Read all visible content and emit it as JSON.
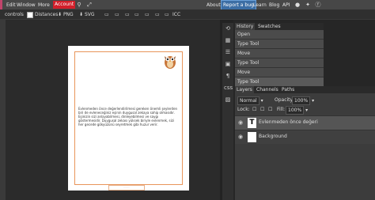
{
  "menu": {
    "items": [
      "Edit",
      "Window",
      "More"
    ],
    "account": "Account",
    "right_links": [
      "About",
      "Learn",
      "Blog",
      "API"
    ],
    "report_bug": "Report a bug"
  },
  "options": {
    "controls_label": "controls",
    "distances_label": "Distances",
    "png_label": "PNG",
    "svg_label": "SVG",
    "icc_label": "ICC"
  },
  "history": {
    "tabs": [
      "History",
      "Swatches"
    ],
    "rows": [
      "Open",
      "Type Tool",
      "Move",
      "Type Tool",
      "Move",
      "Type Tool"
    ]
  },
  "layers": {
    "tabs": [
      "Layers",
      "Channels",
      "Paths"
    ],
    "blend_mode": "Normal",
    "opacity_label": "Opacity:",
    "opacity_value": "100%",
    "lock_label": "Lock:",
    "fill_label": "Fill:",
    "fill_value": "100%",
    "items": [
      {
        "name": "Evlenmeden önce değeri",
        "thumb": "T"
      },
      {
        "name": "Background",
        "thumb": ""
      }
    ]
  },
  "document": {
    "body_text": "Evlenmeden önce değerlendirilmesi gereken önemli şeylerden biri de evleneceğiniz eşinin duygusal zekaya sahip olmasıdır. Eşinizin sizi anlayabilmesi, dinleyebilmesi ve saygı göstermesidir. Duygusal zekası yüksek biriyle evlenmek, sizi her gecede gökyüzünü seyretmek gibi huzur verir.",
    "footer_text": "·········"
  },
  "colors": {
    "accent": "#d21f2a",
    "report_bg": "#3c6ea5",
    "frame": "#e8955a"
  }
}
